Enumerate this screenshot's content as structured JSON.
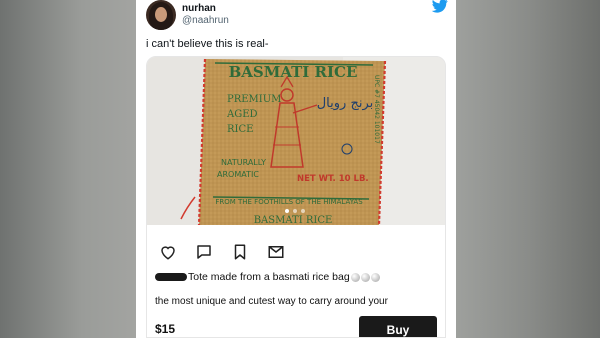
{
  "author": {
    "display_name": "nurhan",
    "handle": "@naahrun"
  },
  "tweet": {
    "text": "i can't believe this is real-"
  },
  "photo": {
    "bag_text": {
      "brand": "BASMATI RICE",
      "premium": "PREMIUM",
      "aged": "AGED",
      "rice": "RICE",
      "arabic": "برنج رویال",
      "naturally": "NATURALLY",
      "aromatic": "AROMATIC",
      "weight": "NET WT. 10 LB.",
      "footer": "FROM THE FOOTHILLS OF THE HIMALAYAS",
      "upc": "UPC #7 45042 101017",
      "bottom": "BASMATI RICE"
    }
  },
  "listing": {
    "caption": "Tote made from a basmati rice bag",
    "description": "the most unique and cutest way to carry around your",
    "price": "$15",
    "buy_label": "Buy"
  },
  "colors": {
    "twitter_blue": "#1d9bf0",
    "burlap": "#c49a58",
    "red_stitch": "#d23a2e"
  }
}
